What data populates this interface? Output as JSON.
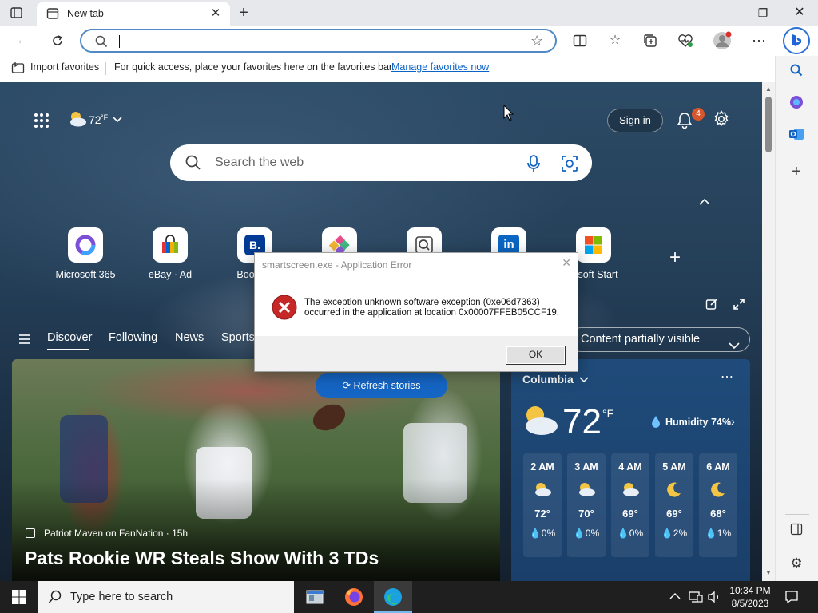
{
  "browser": {
    "tab_title": "New tab",
    "favorites_bar": {
      "import_label": "Import favorites",
      "hint": "For quick access, place your favorites here on the favorites bar.",
      "manage_link": "Manage favorites now"
    }
  },
  "ntp": {
    "weather_temp": "72",
    "weather_unit": "°F",
    "sign_in": "Sign in",
    "notification_count": "4",
    "search_placeholder": "Search the web",
    "quick_links": [
      {
        "label": "Microsoft 365",
        "icon": "microsoft-365-icon"
      },
      {
        "label": "eBay · Ad",
        "icon": "ebay-bag-icon"
      },
      {
        "label": "Booking",
        "icon": "booking-icon"
      },
      {
        "label": "",
        "icon": "colorful-app-icon"
      },
      {
        "label": "",
        "icon": "search-app-icon"
      },
      {
        "label": "",
        "icon": "linkedin-icon"
      },
      {
        "label": "rosoft Start",
        "icon": "microsoft-start-icon"
      }
    ],
    "feed_tabs": [
      "Discover",
      "Following",
      "News",
      "Sports"
    ],
    "content_visibility": "Content partially visible",
    "refresh_button": "Refresh stories",
    "hero": {
      "source": "Patriot Maven on FanNation · 15h",
      "headline": "Pats Rookie WR Steals Show With 3 TDs"
    },
    "weather_card": {
      "location": "Columbia",
      "temp": "72",
      "unit": "°F",
      "humidity": "Humidity 74%",
      "hours": [
        {
          "time": "2 AM",
          "icon": "partly-cloudy-night-icon",
          "temp": "72°",
          "precip": "0%"
        },
        {
          "time": "3 AM",
          "icon": "partly-cloudy-night-icon",
          "temp": "70°",
          "precip": "0%"
        },
        {
          "time": "4 AM",
          "icon": "partly-cloudy-night-icon",
          "temp": "69°",
          "precip": "0%"
        },
        {
          "time": "5 AM",
          "icon": "moon-icon",
          "temp": "69°",
          "precip": "2%"
        },
        {
          "time": "6 AM",
          "icon": "moon-icon",
          "temp": "68°",
          "precip": "1%"
        }
      ]
    }
  },
  "dialog": {
    "title": "smartscreen.exe - Application Error",
    "message_line1": "The exception unknown software exception (0xe06d7363)",
    "message_line2": "occurred in the application at location 0x00007FFEB05CCF19.",
    "ok_label": "OK"
  },
  "taskbar": {
    "search_placeholder": "Type here to search",
    "time": "10:34 PM",
    "date": "8/5/2023"
  },
  "colors": {
    "accent_blue": "#1565c4",
    "error_red": "#c62828",
    "notification_orange": "#d8562b"
  }
}
